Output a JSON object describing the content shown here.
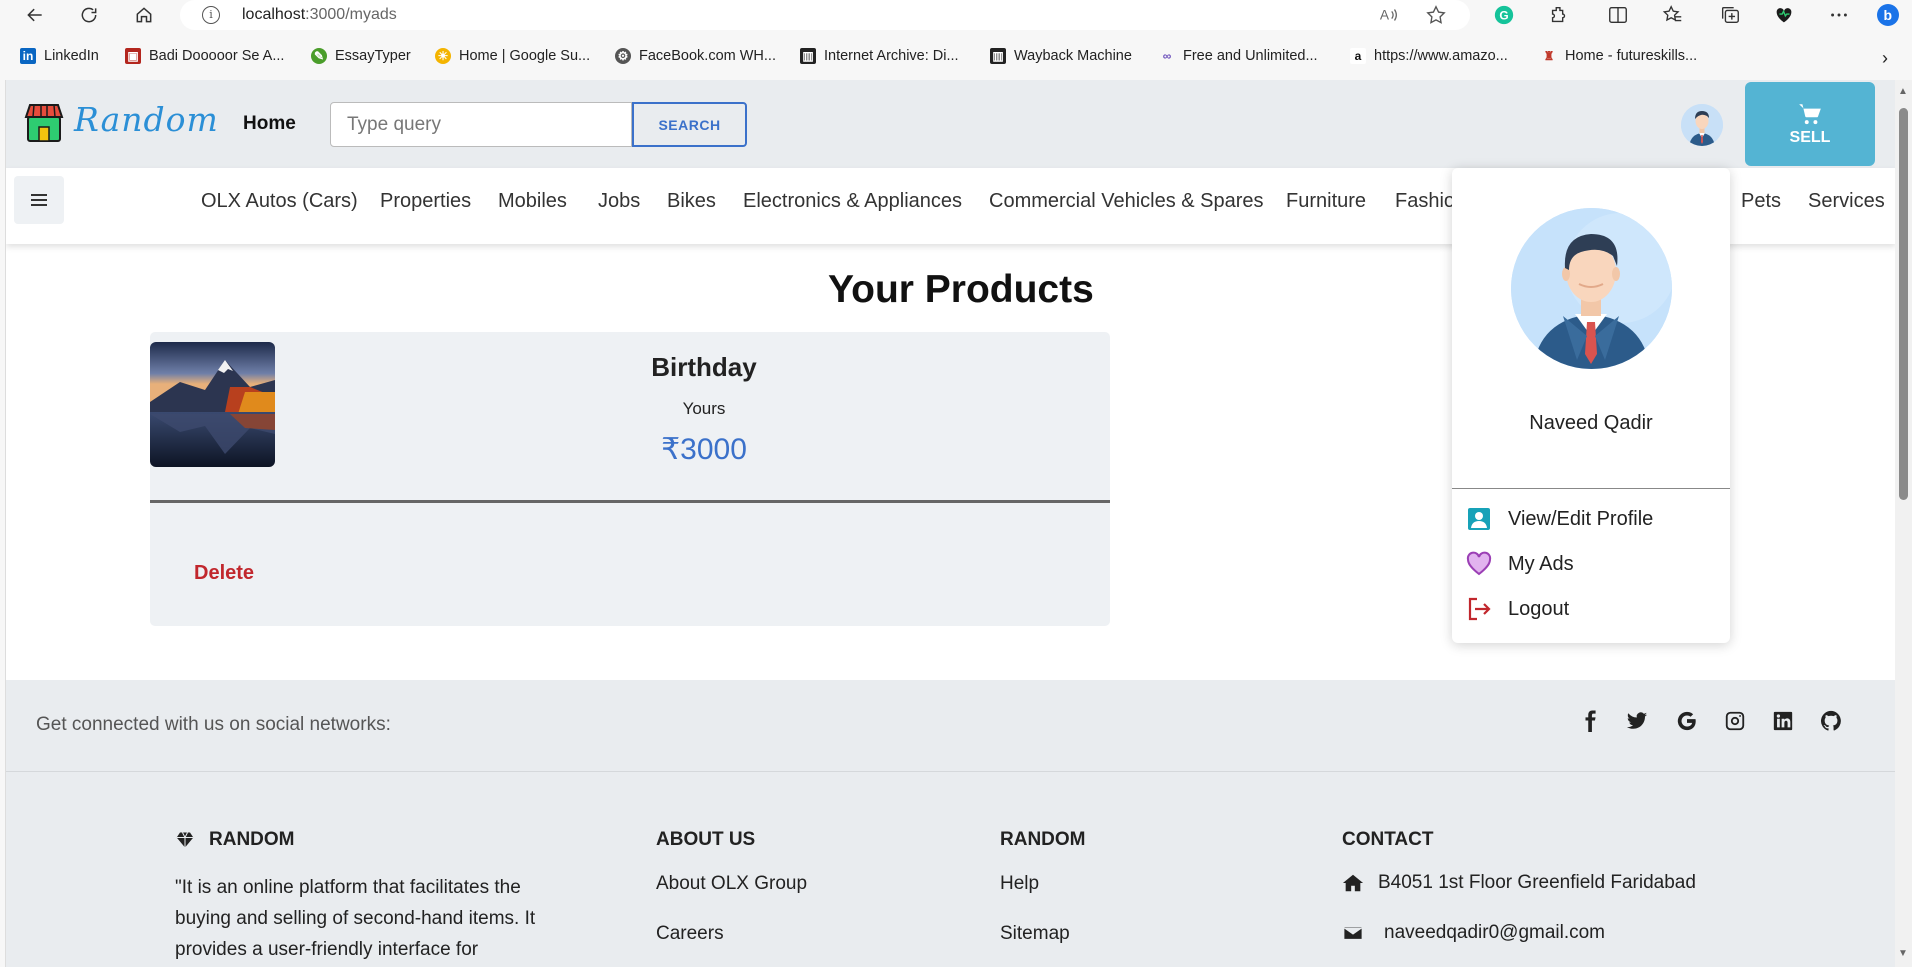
{
  "browser": {
    "url_host": "localhost",
    "url_path": ":3000/myads",
    "bookmarks": [
      {
        "label": "LinkedIn",
        "icon": "linkedin-icon"
      },
      {
        "label": "Badi Dooooor Se A...",
        "icon": "movie-icon"
      },
      {
        "label": "EssayTyper",
        "icon": "pen-icon"
      },
      {
        "label": "Home | Google Su...",
        "icon": "sun-icon"
      },
      {
        "label": "FaceBook.com WH...",
        "icon": "gear-icon"
      },
      {
        "label": "Internet Archive: Di...",
        "icon": "archive-icon"
      },
      {
        "label": "Wayback Machine",
        "icon": "archive-icon"
      },
      {
        "label": "Free and Unlimited...",
        "icon": "infinity-icon"
      },
      {
        "label": "https://www.amazo...",
        "icon": "amazon-icon"
      },
      {
        "label": "Home - futureskills...",
        "icon": "trophy-icon"
      }
    ]
  },
  "header": {
    "logo_text": "Random",
    "home_label": "Home",
    "search_placeholder": "Type query",
    "search_button": "SEARCH",
    "sell_label": "SELL"
  },
  "categories": [
    "OLX Autos (Cars)",
    "Properties",
    "Mobiles",
    "Jobs",
    "Bikes",
    "Electronics & Appliances",
    "Commercial Vehicles & Spares",
    "Furniture",
    "Fashion",
    "Pets",
    "Services"
  ],
  "main": {
    "title": "Your Products",
    "products": [
      {
        "title": "Birthday",
        "subtitle": "Yours",
        "price": "₹3000",
        "delete_label": "Delete"
      }
    ]
  },
  "dropdown": {
    "user_name": "Naveed Qadir",
    "items": [
      {
        "label": "View/Edit Profile",
        "icon": "profile-card-icon"
      },
      {
        "label": "My Ads",
        "icon": "heart-icon"
      },
      {
        "label": "Logout",
        "icon": "logout-icon"
      }
    ]
  },
  "footer": {
    "social_text": "Get connected with us on social networks:",
    "social_icons": [
      "facebook-icon",
      "twitter-icon",
      "google-icon",
      "instagram-icon",
      "linkedin-icon",
      "github-icon"
    ],
    "brand_heading": "RANDOM",
    "brand_description": "\"It is an online platform that facilitates the buying and selling of second-hand items. It provides a user-friendly interface for",
    "about_heading": "ABOUT US",
    "about_links": [
      "About OLX Group",
      "Careers"
    ],
    "random_heading": "RANDOM",
    "random_links": [
      "Help",
      "Sitemap"
    ],
    "contact_heading": "CONTACT",
    "contact_address": "B4051 1st Floor Greenfield Faridabad",
    "contact_email": "naveedqadir0@gmail.com"
  },
  "colors": {
    "accent": "#3b71ca",
    "sell": "#54b4d3",
    "danger": "#c1272d",
    "logo": "#2b8fd6"
  }
}
